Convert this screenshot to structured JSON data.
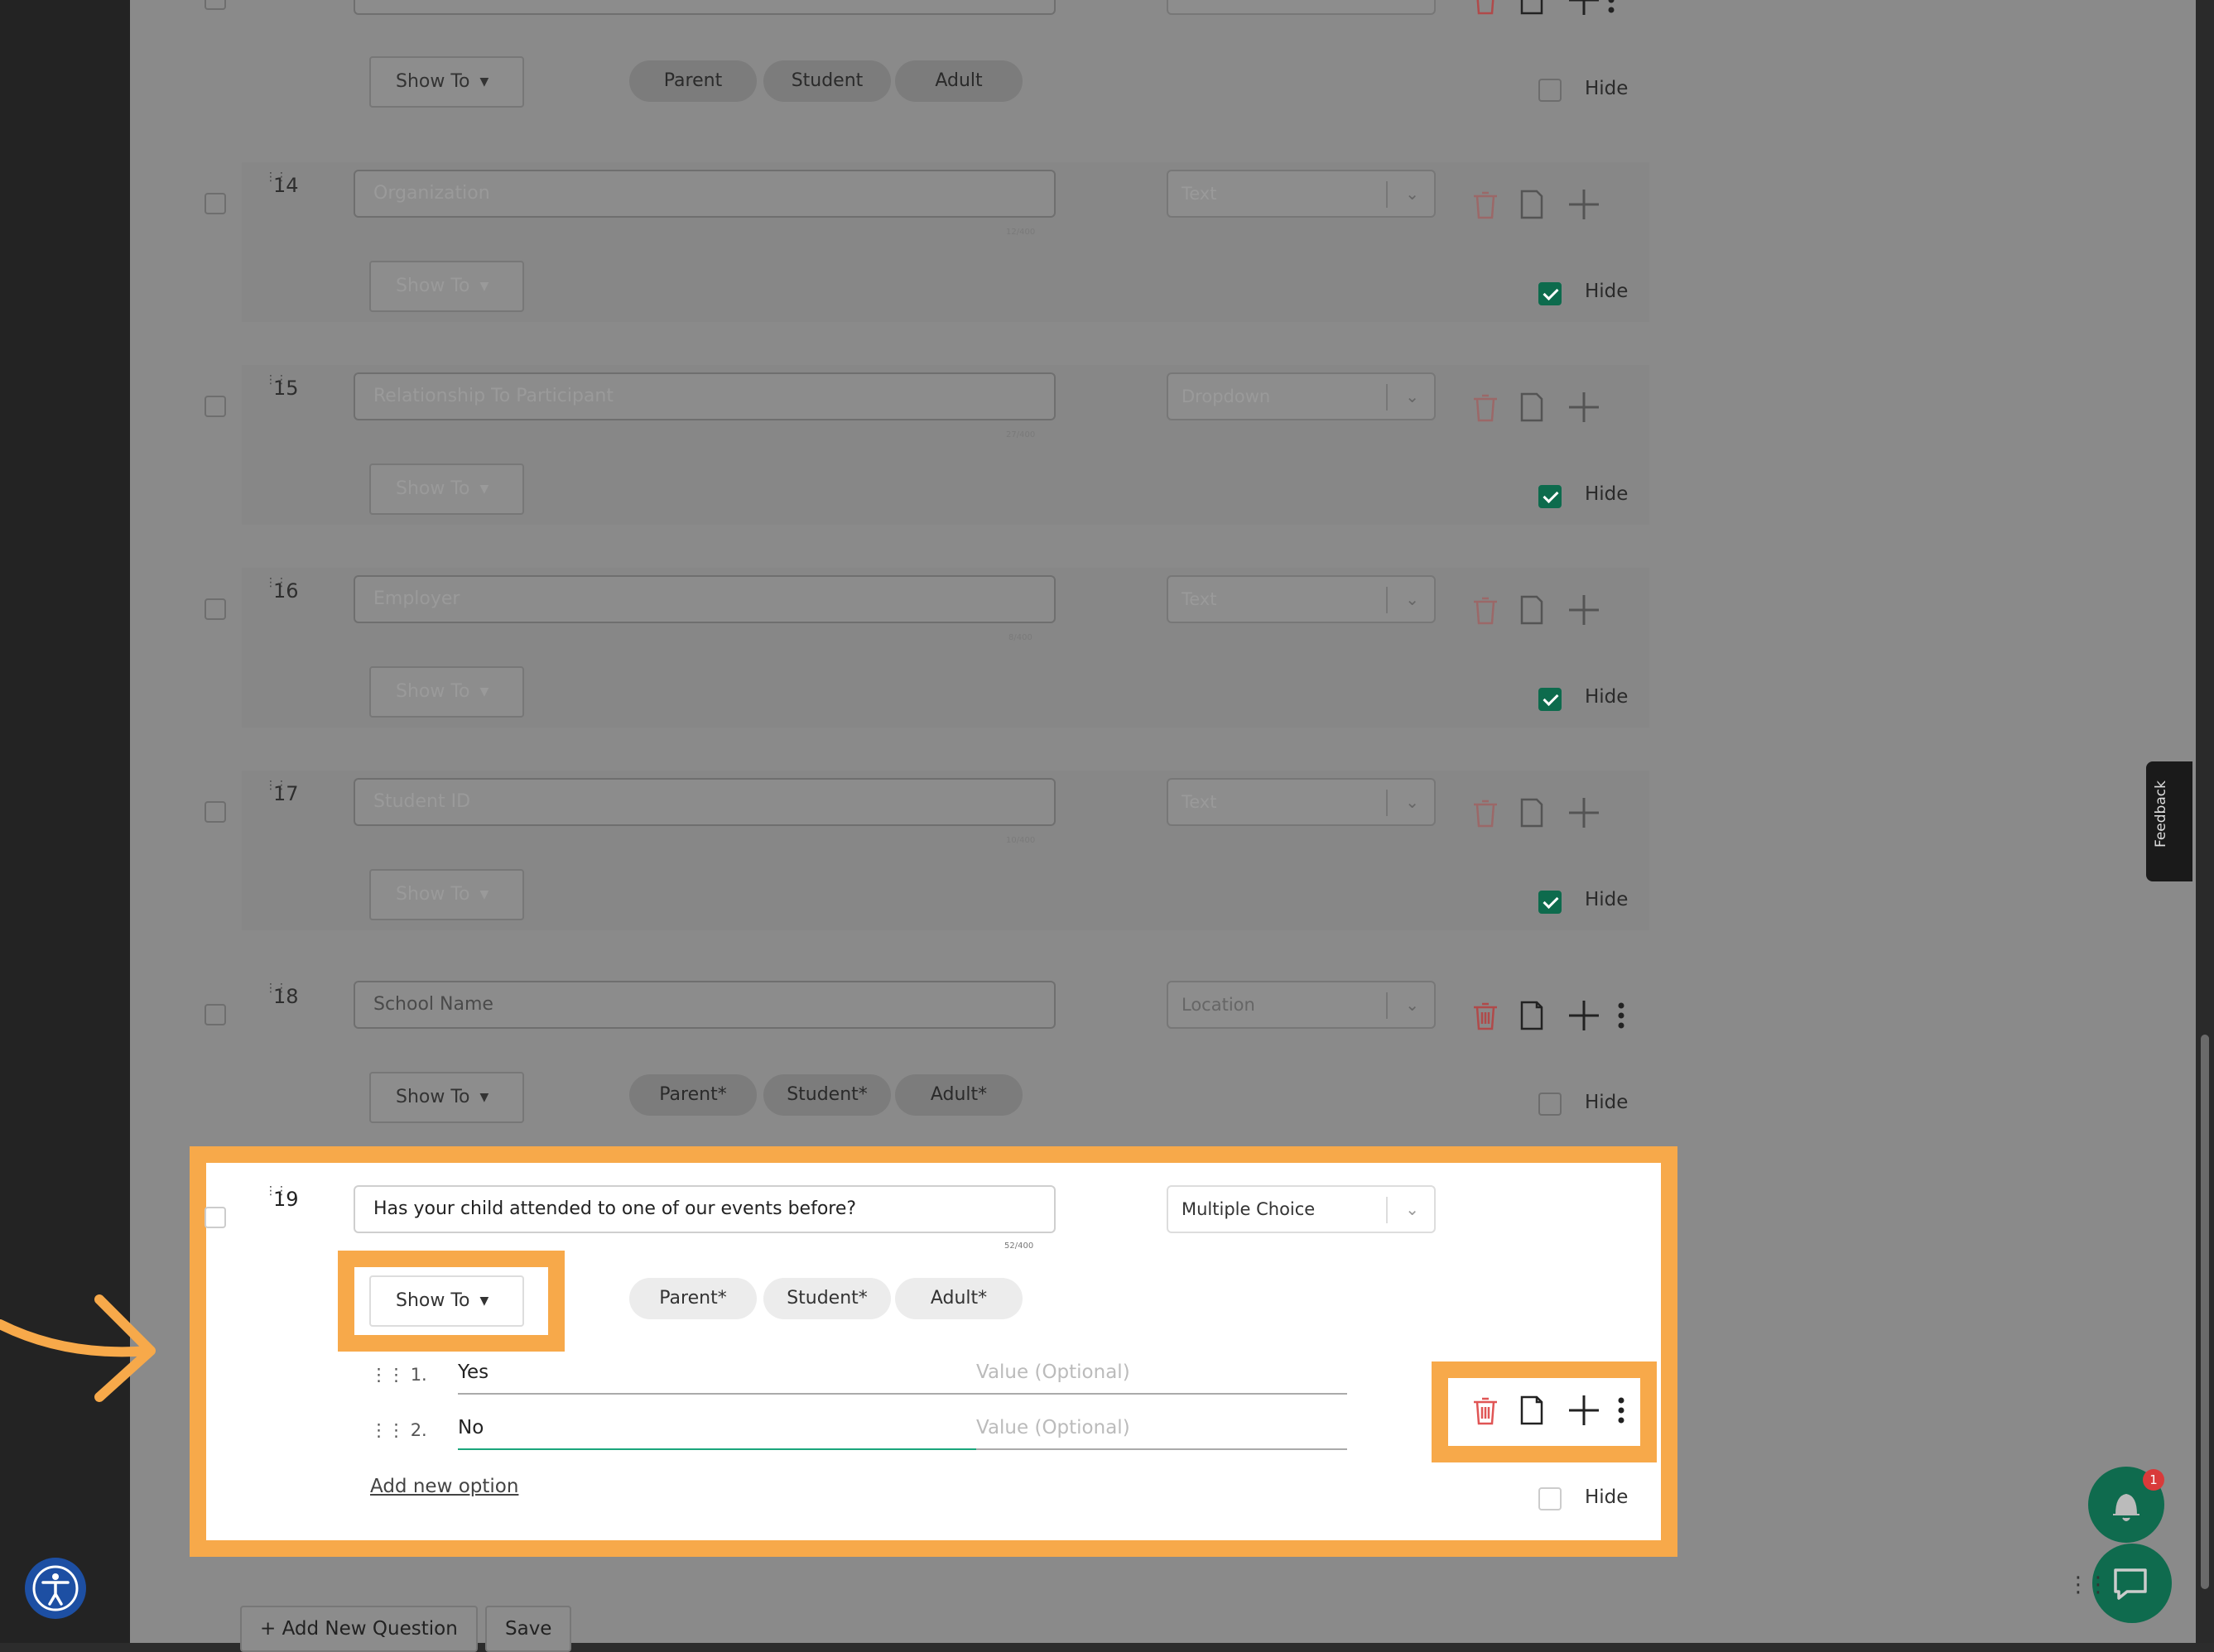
{
  "questions": [
    {
      "number": "14",
      "title": "Organization",
      "counter": "12/400",
      "type": "Text",
      "show_to": "Show To",
      "hidden": true
    },
    {
      "number": "15",
      "title": "Relationship To Participant",
      "counter": "27/400",
      "type": "Dropdown",
      "show_to": "Show To",
      "hidden": true
    },
    {
      "number": "16",
      "title": "Employer",
      "counter": "8/400",
      "type": "Text",
      "show_to": "Show To",
      "hidden": true
    },
    {
      "number": "17",
      "title": "Student ID",
      "counter": "10/400",
      "type": "Text",
      "show_to": "Show To",
      "hidden": true
    },
    {
      "number": "18",
      "title": "School Name",
      "type": "Location",
      "show_to": "Show To",
      "audiences": [
        "Parent*",
        "Student*",
        "Adult*"
      ],
      "hidden": false
    }
  ],
  "top_partial": {
    "show_to": "Show To",
    "audiences": [
      "Parent",
      "Student",
      "Adult"
    ],
    "hide_label": "Hide"
  },
  "active_question": {
    "number": "19",
    "title": "Has your child attended to one of our events before?",
    "counter": "52/400",
    "type": "Multiple Choice",
    "show_to": "Show To",
    "audiences": [
      "Parent*",
      "Student*",
      "Adult*"
    ],
    "options": [
      {
        "number": "1.",
        "label": "Yes",
        "value_placeholder": "Value (Optional)"
      },
      {
        "number": "2.",
        "label": "No",
        "value_placeholder": "Value (Optional)"
      }
    ],
    "add_option_label": "Add new option",
    "hide_label": "Hide"
  },
  "hide_label": "Hide",
  "footer": {
    "add_question_label": "+ Add New Question",
    "save_label": "Save"
  },
  "feedback_label": "Feedback",
  "notification_count": "1",
  "colors": {
    "highlight": "#f7a94a",
    "accent_green": "#0d6b4d",
    "delete_red": "#e05555"
  }
}
